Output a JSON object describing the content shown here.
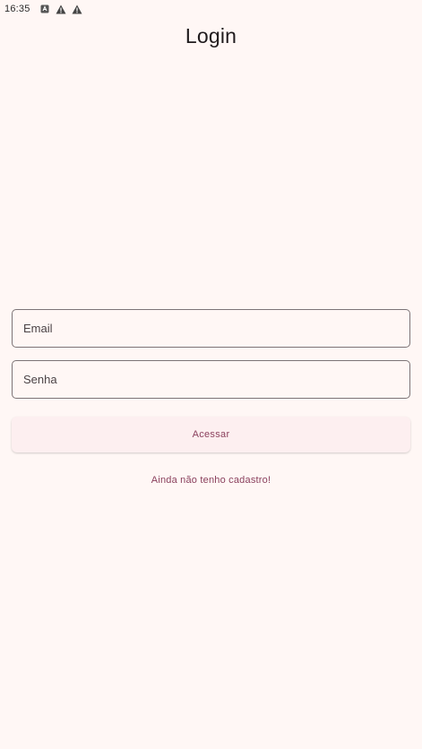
{
  "status_bar": {
    "time": "16:35",
    "icons": [
      "notification-icon",
      "warning-icon",
      "warning-icon"
    ]
  },
  "app_bar": {
    "title": "Login"
  },
  "form": {
    "email_placeholder": "Email",
    "email_value": "",
    "password_placeholder": "Senha",
    "password_value": "",
    "submit_label": "Acessar",
    "register_link": "Ainda não tenho cadastro!"
  },
  "colors": {
    "background": "#fff7f5",
    "accent": "#8a3f5c",
    "button_bg": "#fdeff0",
    "field_border": "#7c7477"
  }
}
